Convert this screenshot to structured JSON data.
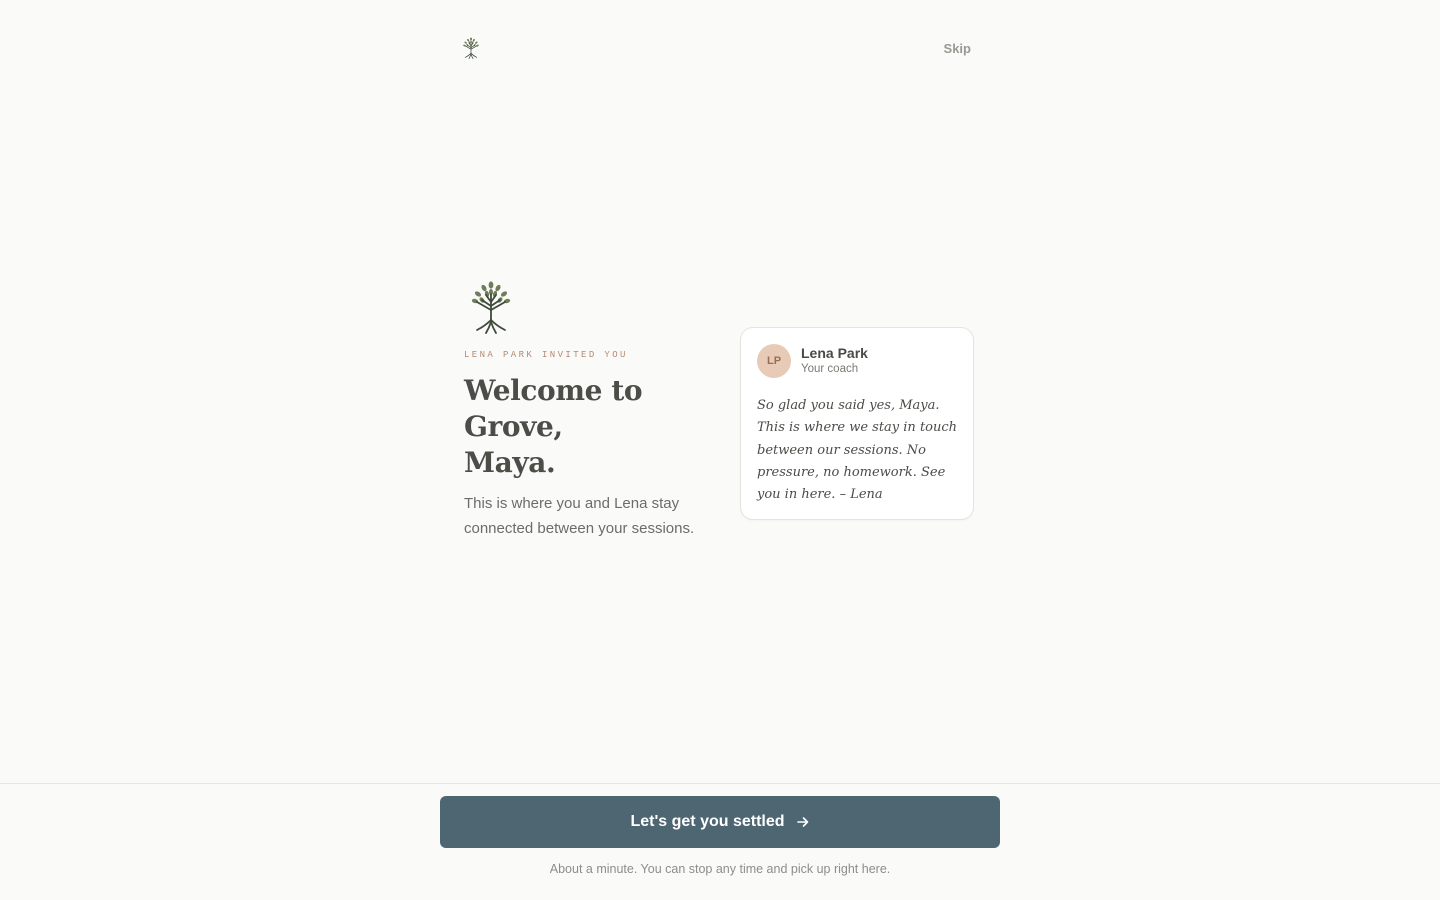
{
  "header": {
    "skip_label": "Skip"
  },
  "hero": {
    "eyebrow": "LENA PARK INVITED YOU",
    "headline_line1": "Welcome to",
    "headline_line2": "Grove,",
    "headline_line3": "Maya.",
    "lead": "This is where you and Lena stay connected between your sessions."
  },
  "coach_card": {
    "initials": "LP",
    "name": "Lena Park",
    "role": "Your coach",
    "quote": "So glad you said yes, Maya. This is where we stay in touch between our sessions. No pressure, no homework. See you in here. – Lena"
  },
  "footer": {
    "cta_label": "Let's get you settled",
    "note": "About a minute. You can stop any time and pick up right here."
  },
  "icons": {
    "brand": "tree-logo-icon",
    "cta": "arrow-right-icon"
  },
  "colors": {
    "background": "#fafaf8",
    "primary_button": "#4d6672",
    "accent_eyebrow": "#b58a72",
    "avatar_bg": "#e8cbb6",
    "tree_leaf": "#6e7e5c",
    "tree_trunk": "#3e4a3a"
  }
}
